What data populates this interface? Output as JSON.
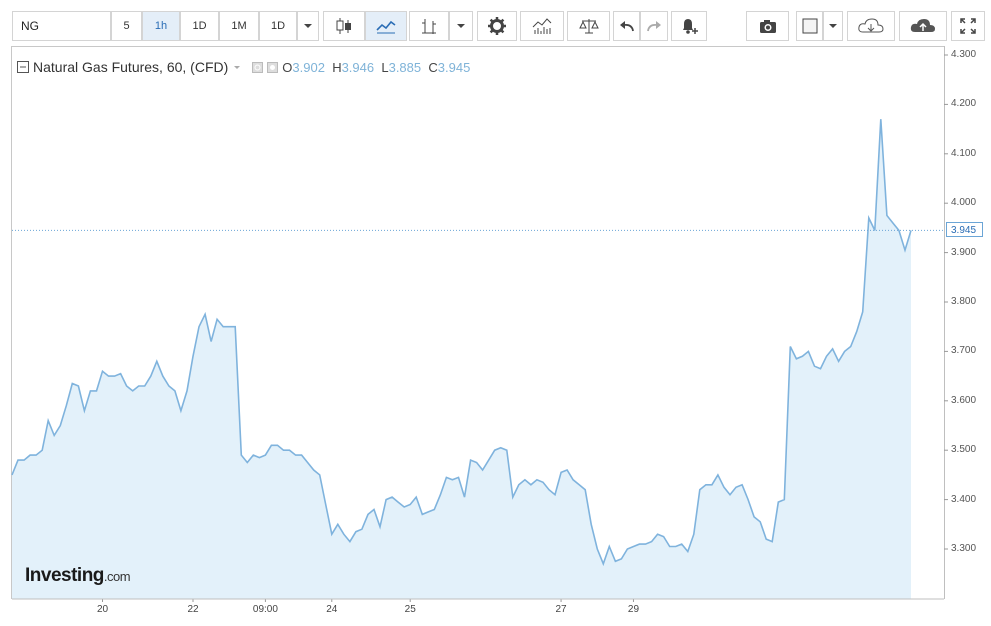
{
  "toolbar": {
    "symbol": "NG",
    "intervals": [
      "5",
      "1h",
      "1D",
      "1M",
      "1D"
    ],
    "active_interval": "1h"
  },
  "legend": {
    "title": "Natural Gas Futures, 60, (CFD)",
    "o_label": "O",
    "o_value": "3.902",
    "h_label": "H",
    "h_value": "3.946",
    "l_label": "L",
    "l_value": "3.885",
    "c_label": "C",
    "c_value": "3.945"
  },
  "last_price_tag": "3.945",
  "watermark": {
    "brand": "Investing",
    "suffix": ".com"
  },
  "colors": {
    "line": "#7fb3dd",
    "area": "#e3f1fa",
    "accent": "#2a6db5"
  },
  "chart_data": {
    "type": "area",
    "title": "Natural Gas Futures, 60, (CFD)",
    "xlabel": "",
    "ylabel": "",
    "ylim": [
      3.2,
      4.3
    ],
    "y_ticks": [
      "4.300",
      "4.200",
      "4.100",
      "4.000",
      "3.900",
      "3.800",
      "3.700",
      "3.600",
      "3.500",
      "3.400",
      "3.300"
    ],
    "x_ticks": [
      {
        "label": "20",
        "i": 15
      },
      {
        "label": "22",
        "i": 30
      },
      {
        "label": "09:00",
        "i": 42
      },
      {
        "label": "24",
        "i": 53
      },
      {
        "label": "25",
        "i": 66
      },
      {
        "label": "27",
        "i": 91
      },
      {
        "label": "29",
        "i": 103
      }
    ],
    "grid": false,
    "last_price": 3.945,
    "series": [
      {
        "values": [
          3.45,
          3.48,
          3.48,
          3.49,
          3.49,
          3.5,
          3.56,
          3.53,
          3.55,
          3.59,
          3.635,
          3.63,
          3.58,
          3.62,
          3.62,
          3.66,
          3.65,
          3.65,
          3.655,
          3.63,
          3.62,
          3.63,
          3.63,
          3.65,
          3.68,
          3.65,
          3.63,
          3.62,
          3.58,
          3.62,
          3.69,
          3.75,
          3.775,
          3.72,
          3.765,
          3.75,
          3.75,
          3.75,
          3.49,
          3.475,
          3.49,
          3.485,
          3.49,
          3.51,
          3.51,
          3.5,
          3.5,
          3.49,
          3.49,
          3.475,
          3.46,
          3.45,
          3.39,
          3.33,
          3.35,
          3.33,
          3.315,
          3.335,
          3.34,
          3.37,
          3.38,
          3.345,
          3.4,
          3.405,
          3.395,
          3.385,
          3.39,
          3.405,
          3.37,
          3.375,
          3.38,
          3.41,
          3.445,
          3.44,
          3.445,
          3.405,
          3.48,
          3.475,
          3.46,
          3.48,
          3.5,
          3.505,
          3.5,
          3.405,
          3.43,
          3.44,
          3.43,
          3.44,
          3.435,
          3.42,
          3.41,
          3.455,
          3.46,
          3.44,
          3.43,
          3.42,
          3.35,
          3.3,
          3.27,
          3.305,
          3.275,
          3.28,
          3.3,
          3.305,
          3.31,
          3.31,
          3.315,
          3.33,
          3.325,
          3.305,
          3.305,
          3.31,
          3.295,
          3.33,
          3.42,
          3.43,
          3.43,
          3.45,
          3.425,
          3.41,
          3.425,
          3.43,
          3.4,
          3.365,
          3.355,
          3.32,
          3.315,
          3.395,
          3.4,
          3.71,
          3.685,
          3.69,
          3.7,
          3.67,
          3.665,
          3.69,
          3.705,
          3.68,
          3.7,
          3.71,
          3.74,
          3.78,
          3.97,
          3.945,
          4.17,
          3.975,
          3.96,
          3.945,
          3.905,
          3.945
        ]
      }
    ]
  }
}
